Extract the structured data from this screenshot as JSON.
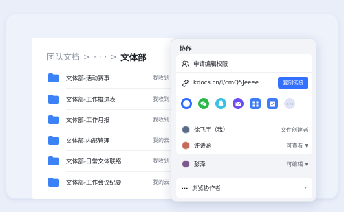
{
  "breadcrumb": {
    "root": "团队文档",
    "separator": ">",
    "ellipsis": "· · ·",
    "current": "文体部"
  },
  "files": [
    {
      "name": "文体部-活动赛事",
      "meta": "我收到"
    },
    {
      "name": "文体部-工作推进表",
      "meta": "我收到"
    },
    {
      "name": "文体部-工作月报",
      "meta": "我收到"
    },
    {
      "name": "文体部-内部管理",
      "meta": "我的云"
    },
    {
      "name": "文体部-日常文体联络",
      "meta": "我收到"
    },
    {
      "name": "文体部-工作会议纪要",
      "meta": "我的云"
    }
  ],
  "share": {
    "title": "协作",
    "request_edit": "申请编辑权限",
    "link": "kdocs.cn/l/cmQ5Jeeee",
    "copy_button": "复制链接",
    "apps": [
      {
        "icon": "wps-ring-icon",
        "color": "#2f6bff"
      },
      {
        "icon": "wechat-icon",
        "color": "#2bb84a"
      },
      {
        "icon": "qq-icon",
        "color": "#37c2e6"
      },
      {
        "icon": "mail-icon",
        "color": "#6a4df0"
      },
      {
        "icon": "apps-grid-icon",
        "color": "#3d7cf5"
      },
      {
        "icon": "doc-share-icon",
        "color": "#3d7cf5"
      },
      {
        "icon": "more-icon",
        "color": "#dfe5f5"
      }
    ],
    "members": [
      {
        "name": "徐飞宇（我）",
        "role": "文件创建者",
        "avatar": "#5b6b86",
        "has_menu": false
      },
      {
        "name": "许诗涵",
        "role": "可查看",
        "avatar": "#c46a5a",
        "has_menu": true
      },
      {
        "name": "彭泽",
        "role": "可编辑",
        "avatar": "#7a5a8a",
        "has_menu": true
      }
    ],
    "browse_collaborators": "浏览协作者"
  }
}
